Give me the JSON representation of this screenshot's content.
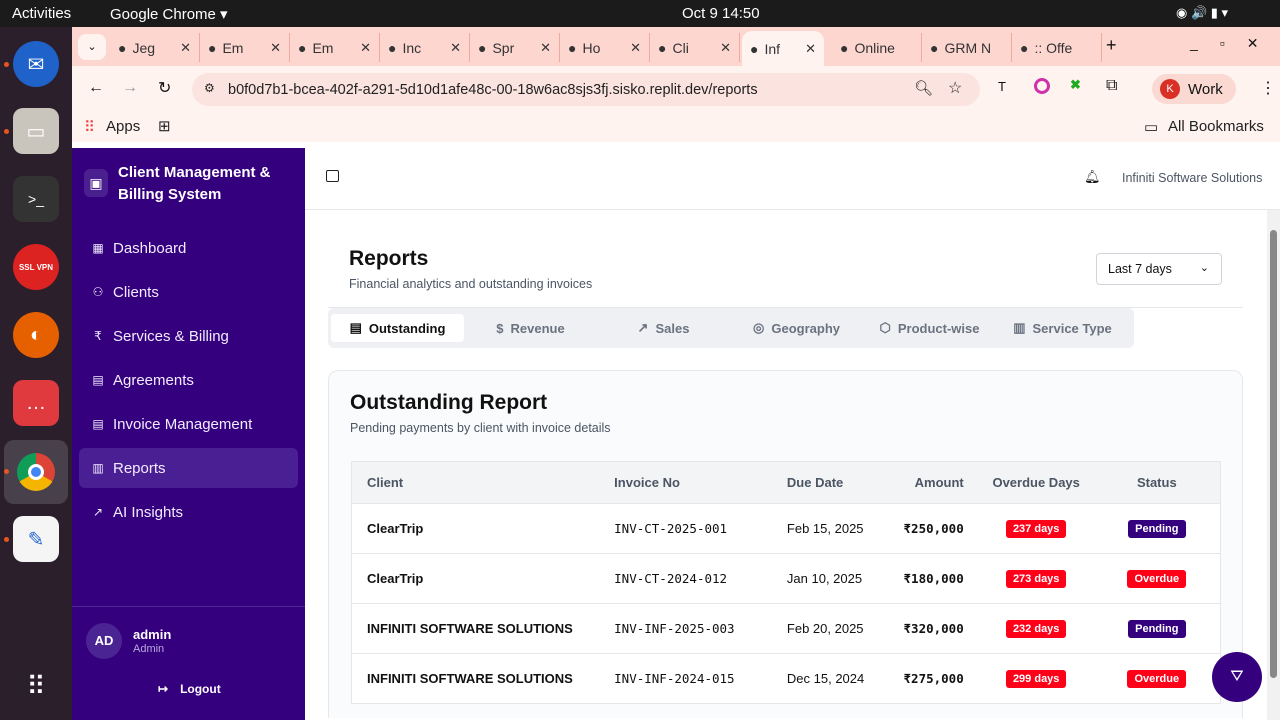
{
  "os": {
    "activities": "Activities",
    "app": "Google Chrome",
    "datetime": "Oct 9  14:50"
  },
  "browser": {
    "tabs": [
      {
        "label": "Jeg"
      },
      {
        "label": "Em"
      },
      {
        "label": "Em"
      },
      {
        "label": "Inc"
      },
      {
        "label": "Spr"
      },
      {
        "label": "Ho"
      },
      {
        "label": "Cli"
      },
      {
        "label": "Inf",
        "active": true
      },
      {
        "label": "Online"
      },
      {
        "label": "GRM N"
      },
      {
        "label": ":: Offe"
      }
    ],
    "url": "b0f0d7b1-bcea-402f-a291-5d10d1afe48c-00-18w6ac8sjs3fj.sisko.replit.dev/reports",
    "profile": "Work",
    "profile_initial": "K",
    "bookmarks": {
      "apps": "Apps",
      "all": "All Bookmarks"
    }
  },
  "sidebar": {
    "title": "Client Management & Billing System",
    "items": [
      {
        "label": "Dashboard",
        "icon": "grid-icon"
      },
      {
        "label": "Clients",
        "icon": "users-icon"
      },
      {
        "label": "Services & Billing",
        "icon": "rupee-icon"
      },
      {
        "label": "Agreements",
        "icon": "document-icon"
      },
      {
        "label": "Invoice Management",
        "icon": "document-icon"
      },
      {
        "label": "Reports",
        "icon": "bar-chart-icon",
        "active": true
      },
      {
        "label": "AI Insights",
        "icon": "trending-up-icon"
      }
    ],
    "user": {
      "initials": "AD",
      "name": "admin",
      "role": "Admin"
    },
    "logout": "Logout"
  },
  "header": {
    "company": "Infiniti Software Solutions"
  },
  "page": {
    "title": "Reports",
    "subtitle": "Financial analytics and outstanding invoices",
    "range": "Last 7 days"
  },
  "report_tabs": [
    {
      "label": "Outstanding",
      "icon": "document-icon"
    },
    {
      "label": "Revenue",
      "icon": "dollar-icon"
    },
    {
      "label": "Sales",
      "icon": "trending-up-icon"
    },
    {
      "label": "Geography",
      "icon": "map-pin-icon"
    },
    {
      "label": "Product-wise",
      "icon": "package-icon"
    },
    {
      "label": "Service Type",
      "icon": "building-icon"
    }
  ],
  "outstanding": {
    "title": "Outstanding Report",
    "subtitle": "Pending payments by client with invoice details",
    "columns": [
      "Client",
      "Invoice No",
      "Due Date",
      "Amount",
      "Overdue Days",
      "Status"
    ],
    "rows": [
      {
        "client": "ClearTrip",
        "invoice": "INV-CT-2025-001",
        "due": "Feb 15, 2025",
        "amount": "₹250,000",
        "overdue": "237 days",
        "status": "Pending"
      },
      {
        "client": "ClearTrip",
        "invoice": "INV-CT-2024-012",
        "due": "Jan 10, 2025",
        "amount": "₹180,000",
        "overdue": "273 days",
        "status": "Overdue"
      },
      {
        "client": "INFINITI SOFTWARE SOLUTIONS",
        "invoice": "INV-INF-2025-003",
        "due": "Feb 20, 2025",
        "amount": "₹320,000",
        "overdue": "232 days",
        "status": "Pending"
      },
      {
        "client": "INFINITI SOFTWARE SOLUTIONS",
        "invoice": "INV-INF-2024-015",
        "due": "Dec 15, 2024",
        "amount": "₹275,000",
        "overdue": "299 days",
        "status": "Overdue"
      }
    ]
  },
  "colors": {
    "sidebar": "#34007e",
    "pending": "#34007e",
    "overdue": "#ff0019"
  }
}
